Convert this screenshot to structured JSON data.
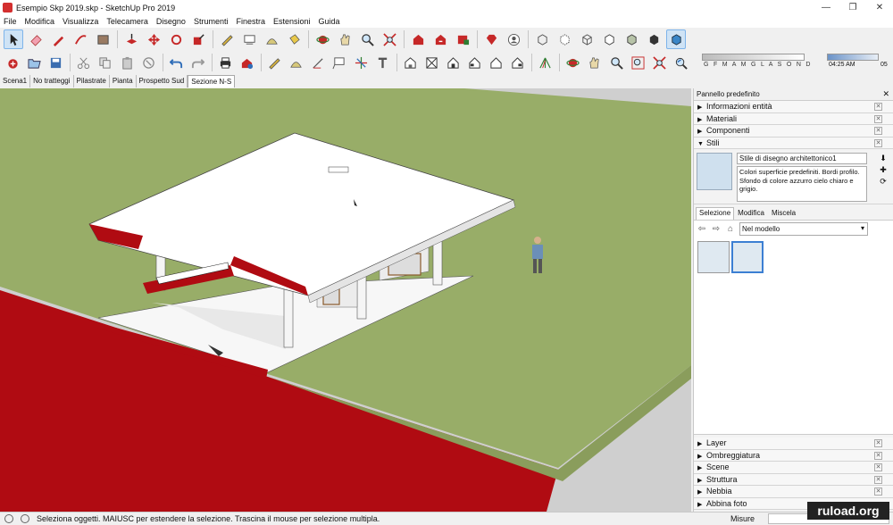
{
  "window": {
    "title": "Esempio Skp 2019.skp - SketchUp Pro 2019",
    "controls": [
      "—",
      "❐",
      "✕"
    ]
  },
  "menu": [
    "File",
    "Modifica",
    "Visualizza",
    "Telecamera",
    "Disegno",
    "Strumenti",
    "Finestra",
    "Estensioni",
    "Guida"
  ],
  "shadow": {
    "months": "G F M A M G L A S O N D",
    "time_start": "04:25 AM",
    "time_end": "05"
  },
  "scene_tabs": [
    "Scena1",
    "No tratteggi",
    "Pilastrate",
    "Pianta",
    "Prospetto Sud",
    "Sezione N-S"
  ],
  "active_scene": 5,
  "panel": {
    "title": "Pannello predefinito",
    "top_trays": [
      {
        "label": "Informazioni entità",
        "open": false
      },
      {
        "label": "Materiali",
        "open": false
      },
      {
        "label": "Componenti",
        "open": false
      },
      {
        "label": "Stili",
        "open": true
      }
    ],
    "style": {
      "name": "Stile di disegno architettonico1",
      "description": "Colori superficie predefiniti. Bordi profilo. Sfondo di colore azzurro cielo chiaro e grigio.",
      "tabs": [
        "Selezione",
        "Modifica",
        "Miscela"
      ],
      "select_value": "Nel modello"
    },
    "bottom_trays": [
      "Layer",
      "Ombreggiatura",
      "Scene",
      "Struttura",
      "Nebbia",
      "Abbina foto"
    ]
  },
  "status": {
    "text": "Seleziona oggetti. MAIUSC per estendere la selezione. Trascina il mouse per selezione multipla.",
    "measure_label": "Misure"
  },
  "watermark": "ruload.org"
}
